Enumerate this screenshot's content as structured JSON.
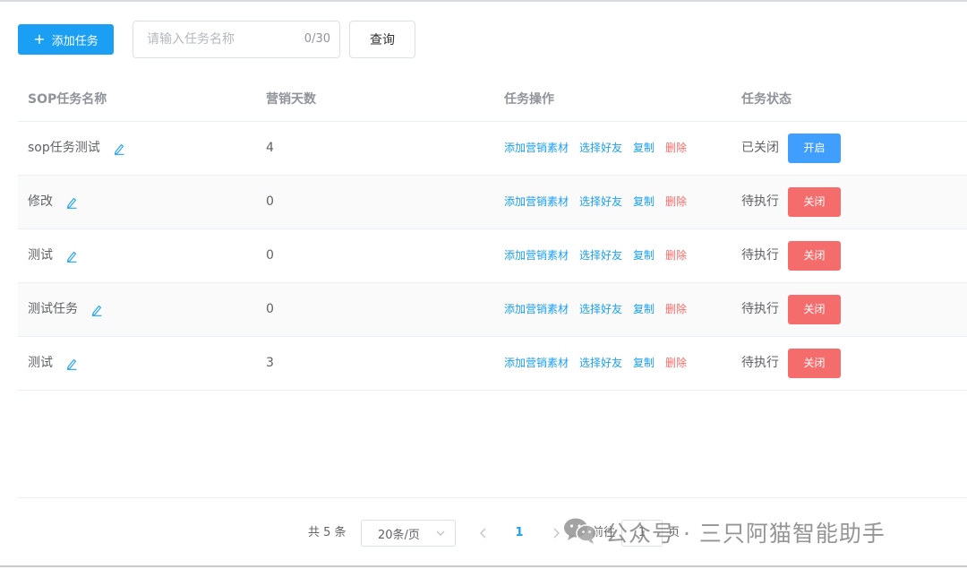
{
  "toolbar": {
    "add_label": "添加任务",
    "search_placeholder": "请输入任务名称",
    "search_value": "",
    "search_count": "0/30",
    "query_label": "查询"
  },
  "table": {
    "columns": [
      "SOP任务名称",
      "营销天数",
      "任务操作",
      "任务状态"
    ],
    "ops": {
      "add_material": "添加营销素材",
      "choose_friends": "选择好友",
      "copy": "复制",
      "delete": "删除"
    },
    "rows": [
      {
        "name": "sop任务测试",
        "days": "4",
        "status": "已关闭",
        "action": "开启"
      },
      {
        "name": "修改",
        "days": "0",
        "status": "待执行",
        "action": "关闭"
      },
      {
        "name": "测试",
        "days": "0",
        "status": "待执行",
        "action": "关闭"
      },
      {
        "name": "测试任务",
        "days": "0",
        "status": "待执行",
        "action": "关闭"
      },
      {
        "name": "测试",
        "days": "3",
        "status": "待执行",
        "action": "关闭"
      }
    ]
  },
  "pagination": {
    "total": "共 5 条",
    "page_size": "20条/页",
    "current_page": "1",
    "goto_label": "前往",
    "goto_value": "1",
    "goto_unit": "页"
  },
  "watermark": {
    "text": "公众号 · 三只阿猫智能助手"
  },
  "colors": {
    "primary": "#1a9ff5",
    "danger": "#f56c6c",
    "open_button": "#409eff"
  },
  "icons": {
    "edit": "edit-icon",
    "plus": "plus-icon",
    "prev": "chevron-left-icon",
    "next": "chevron-right-icon",
    "dropdown": "chevron-down-icon",
    "wechat": "wechat-icon"
  }
}
